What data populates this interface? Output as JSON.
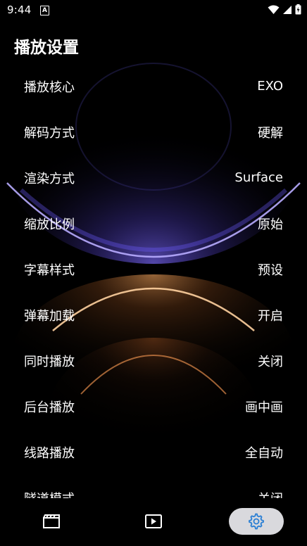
{
  "status_bar": {
    "time": "9:44",
    "notification_icon": "a-icon",
    "icons": [
      "wifi-icon",
      "signal-icon",
      "battery-icon"
    ]
  },
  "page": {
    "title": "播放设置"
  },
  "settings": [
    {
      "label": "播放核心",
      "value": "EXO"
    },
    {
      "label": "解码方式",
      "value": "硬解"
    },
    {
      "label": "渲染方式",
      "value": "Surface"
    },
    {
      "label": "缩放比例",
      "value": "原始"
    },
    {
      "label": "字幕样式",
      "value": "预设"
    },
    {
      "label": "弹幕加载",
      "value": "开启"
    },
    {
      "label": "同时播放",
      "value": "关闭"
    },
    {
      "label": "后台播放",
      "value": "画中画"
    },
    {
      "label": "线路播放",
      "value": "全自动"
    },
    {
      "label": "隧道模式",
      "value": "关闭"
    }
  ],
  "bottom_nav": {
    "items": [
      "film-icon",
      "play-icon",
      "gear-icon"
    ],
    "active_index": 2,
    "active_color": "#2a7fd4"
  }
}
